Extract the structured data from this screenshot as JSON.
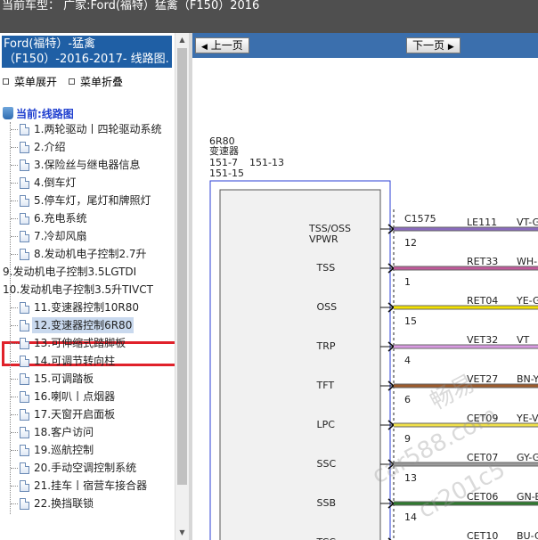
{
  "topbar": {
    "title": "当前车型：  广家:Ford(福特）猛禽（F150）2016"
  },
  "sidebar": {
    "header_line1": "Ford(福特）-猛禽",
    "header_line2": "（F150）-2016-2017- 线路图.",
    "expand_label": "菜单展开",
    "collapse_label": "菜单折叠",
    "current_label": "当前:线路图",
    "items": [
      {
        "label": "1.两轮驱动丨四轮驱动系统",
        "level": 2
      },
      {
        "label": "2.介绍",
        "level": 2
      },
      {
        "label": "3.保险丝与继电器信息",
        "level": 2
      },
      {
        "label": "4.倒车灯",
        "level": 2
      },
      {
        "label": "5.停车灯，尾灯和牌照灯",
        "level": 2
      },
      {
        "label": "6.充电系统",
        "level": 2
      },
      {
        "label": "7.冷却风扇",
        "level": 2
      },
      {
        "label": "8.发动机电子控制2.7升",
        "level": 2
      },
      {
        "label": "9.发动机电子控制3.5LGTDI",
        "level": 1
      },
      {
        "label": "10.发动机电子控制3.5升TIVCT",
        "level": 1
      },
      {
        "label": "11.变速器控制10R80",
        "level": 2
      },
      {
        "label": "12.变速器控制6R80",
        "level": 2,
        "selected": true
      },
      {
        "label": "13.可伸缩式踏脚板",
        "level": 2
      },
      {
        "label": "14.可调节转向柱",
        "level": 2
      },
      {
        "label": "15.可调踏板",
        "level": 2
      },
      {
        "label": "16.喇叭丨点烟器",
        "level": 2
      },
      {
        "label": "17.天窗开启面板",
        "level": 2
      },
      {
        "label": "18.客户访问",
        "level": 2
      },
      {
        "label": "19.巡航控制",
        "level": 2
      },
      {
        "label": "20.手动空调控制系统",
        "level": 2
      },
      {
        "label": "21.挂车丨宿营车接合器",
        "level": 2
      },
      {
        "label": "22.换挡联锁",
        "level": 2
      }
    ]
  },
  "viewer": {
    "prev_label": "上一页",
    "next_label": "下一页",
    "module": {
      "name": "6R80",
      "desc": "变速器",
      "ref1": "151-7",
      "ref2": "151-13",
      "ref3": "151-15",
      "connector": "C1575"
    },
    "pins": [
      {
        "signal": "TSS/OSS",
        "signal2": "VPWR",
        "pin": "12",
        "circuit": "LE111",
        "color_code": "VT-G",
        "wire_color": "#8a6bbd"
      },
      {
        "signal": "TSS",
        "pin": "1",
        "circuit": "RET33",
        "color_code": "WH-",
        "wire_color": "#c05a9a"
      },
      {
        "signal": "OSS",
        "pin": "15",
        "circuit": "RET04",
        "color_code": "YE-G",
        "wire_color": "#f2e000"
      },
      {
        "signal": "TRP",
        "pin": "4",
        "circuit": "VET32",
        "color_code": "VT",
        "wire_color": "#d99be2"
      },
      {
        "signal": "TFT",
        "pin": "6",
        "circuit": "VET27",
        "color_code": "BN-Y",
        "wire_color": "#9c5b2c"
      },
      {
        "signal": "LPC",
        "pin": "9",
        "circuit": "CET09",
        "color_code": "YE-V",
        "wire_color": "#f0e04a"
      },
      {
        "signal": "SSC",
        "pin": "13",
        "circuit": "CET07",
        "color_code": "GY-G",
        "wire_color": "#9a9a9a"
      },
      {
        "signal": "SSB",
        "pin": "14",
        "circuit": "CET06",
        "color_code": "GN-B",
        "wire_color": "#2f7a2f"
      },
      {
        "signal": "TCC",
        "pin": "",
        "circuit": "CET10",
        "color_code": "BU-G",
        "wire_color": "#2a5fcf"
      }
    ],
    "watermark1": "畅易",
    "watermark2": "car588.com",
    "watermark3": "cr201c5"
  }
}
